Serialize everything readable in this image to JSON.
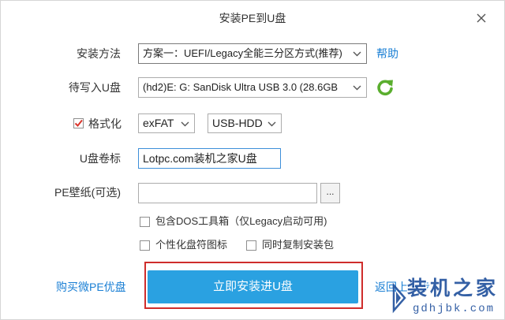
{
  "window": {
    "title": "安装PE到U盘"
  },
  "form": {
    "install_method": {
      "label": "安装方法",
      "value": "方案一：UEFI/Legacy全能三分区方式(推荐)",
      "help_link": "帮助"
    },
    "target_drive": {
      "label": "待写入U盘",
      "value": "(hd2)E: G: SanDisk Ultra USB 3.0 (28.6GB"
    },
    "format": {
      "label": "格式化",
      "checked": true,
      "filesystem": "exFAT",
      "boot_mode": "USB-HDD"
    },
    "volume_label": {
      "label": "U盘卷标",
      "value": "Lotpc.com装机之家U盘"
    },
    "wallpaper": {
      "label": "PE壁纸(可选)",
      "browse_label": "..."
    },
    "options": [
      {
        "label": "包含DOS工具箱（仅Legacy启动可用)",
        "checked": false
      },
      {
        "label": "个性化盘符图标",
        "checked": false
      },
      {
        "label": "同时复制安装包",
        "checked": false
      }
    ]
  },
  "footer": {
    "buy_link": "购买微PE优盘",
    "install_button": "立即安装进U盘",
    "back_link": "返回上一步"
  },
  "watermark": {
    "brand": "装机之家",
    "domain": "gdhjbk.com"
  },
  "icons": {
    "close": "close-icon",
    "dropdown": "chevron-down-icon",
    "refresh": "refresh-icon",
    "check": "checkmark-icon"
  },
  "colors": {
    "accent": "#2aa1e1",
    "link": "#1a7fd4",
    "focus": "#3d8fd9",
    "annotation": "#cf2d2b",
    "check": "#d9342b",
    "refresh": "#5aae2e",
    "watermark": "#1f4f9c"
  }
}
